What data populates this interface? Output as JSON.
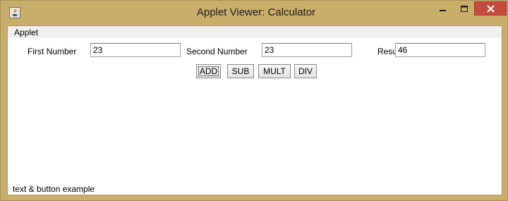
{
  "window": {
    "title": "Applet Viewer: Calculator",
    "icons": {
      "app": "java-icon",
      "minimize": "minimize-icon",
      "maximize": "maximize-icon",
      "close": "close-icon"
    },
    "colors": {
      "frame": "#c9ad6b",
      "close_button": "#c74a3e"
    }
  },
  "menu": {
    "applet_label": "Applet"
  },
  "form": {
    "first_label": "First Number",
    "first_value": "23",
    "second_label": "Second Number",
    "second_value": "23",
    "result_label": "Result",
    "result_value": "46"
  },
  "buttons": {
    "add": "ADD",
    "sub": "SUB",
    "mult": "MULT",
    "div": "DIV"
  },
  "status": {
    "text": "text & button example"
  }
}
